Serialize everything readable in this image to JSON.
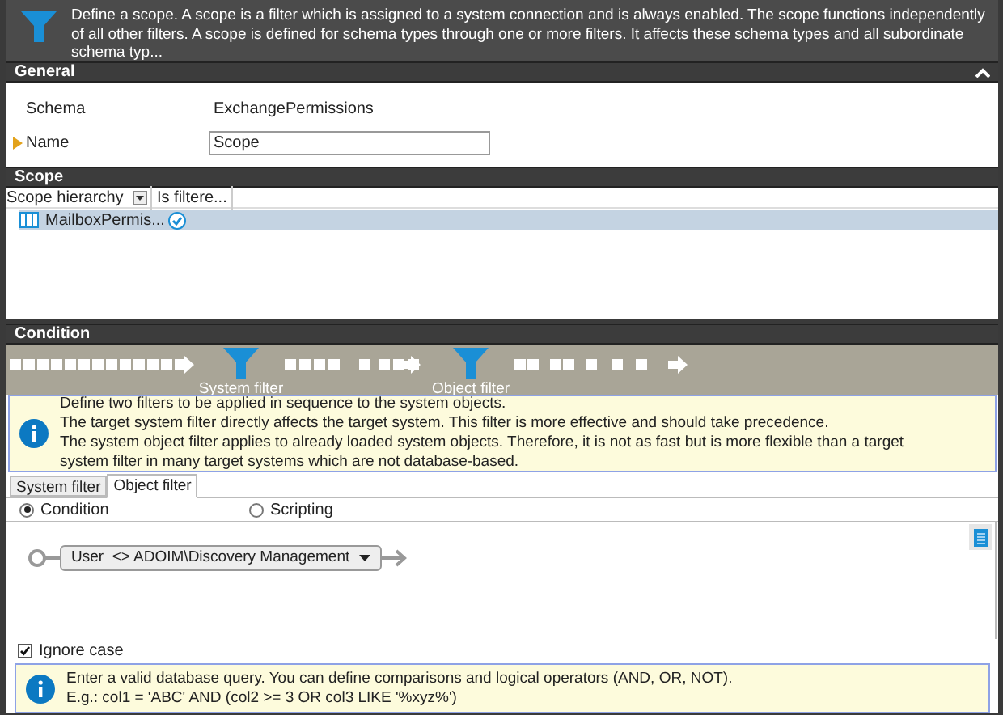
{
  "header": {
    "description": "Define a scope. A scope is a filter which is assigned to a system connection and is always enabled. The scope functions independently of all other filters. A scope is defined for schema types through one or more filters. It affects these schema types and all subordinate schema typ..."
  },
  "general": {
    "title": "General",
    "expanded": true,
    "fields": [
      {
        "label": "Schema",
        "value": "ExchangePermissions",
        "kind": "text",
        "required": false
      },
      {
        "label": "Name",
        "value": "Scope",
        "kind": "input",
        "required": true
      }
    ]
  },
  "scope": {
    "title": "Scope",
    "columns": [
      "Scope hierarchy",
      "Is filtere..."
    ],
    "rows": [
      {
        "name": "MailboxPermis...",
        "filtered": true,
        "selected": true
      }
    ]
  },
  "condition": {
    "title": "Condition",
    "pipeline": [
      "System filter",
      "Object filter"
    ],
    "info": [
      "Define two filters to be applied in sequence to the system objects.",
      "The target system filter directly affects the target system. This filter is more effective and should take precedence.",
      "The system object filter applies to already loaded system objects. Therefore, it is not as fast but is more flexible than a target system filter in many target systems which are not database-based."
    ],
    "tabs": [
      {
        "label": "System filter",
        "selected": false
      },
      {
        "label": "Object filter",
        "selected": true
      }
    ],
    "modes": [
      {
        "label": "Condition",
        "selected": true
      },
      {
        "label": "Scripting",
        "selected": false
      }
    ],
    "expression": "User  <> ADOIM\\Discovery Management",
    "ignore_case": {
      "label": "Ignore case",
      "checked": true
    },
    "hint": [
      "Enter a valid database query. You can define comparisons and logical operators (AND, OR, NOT).",
      "E.g.: col1 = 'ABC' AND (col2 >= 3 OR col3 LIKE '%xyz%')"
    ]
  }
}
